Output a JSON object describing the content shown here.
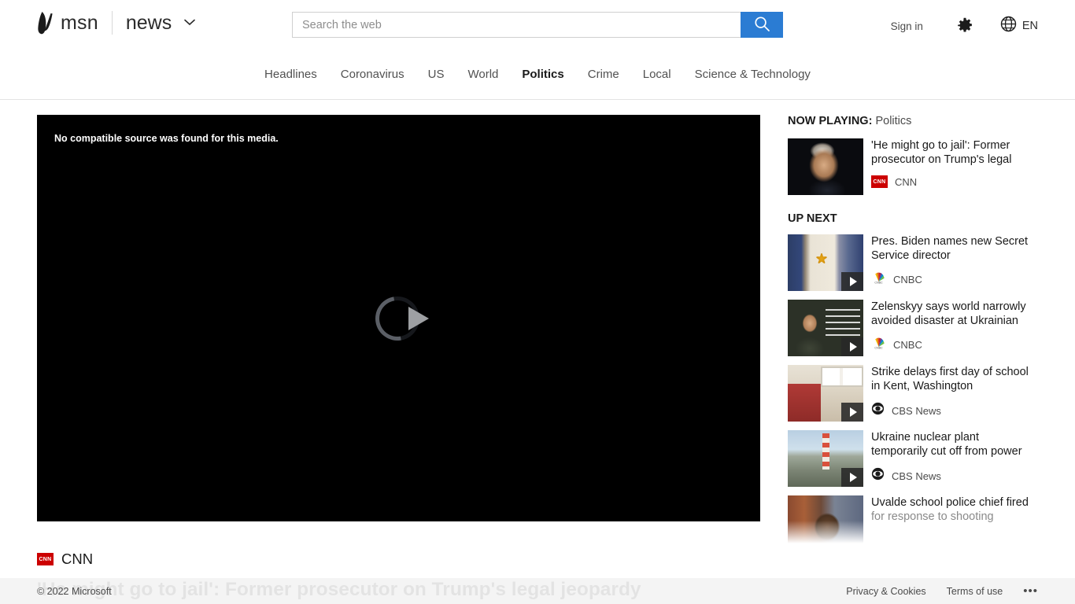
{
  "header": {
    "brand": "msn",
    "brand_logo_icon": "msn-butterfly-logo",
    "vertical": "news",
    "vertical_chevron_icon": "chevron-down-icon",
    "search": {
      "placeholder": "Search the web",
      "value": "",
      "button_icon": "search-icon",
      "button_color": "#2b7cd3"
    },
    "sign_in": "Sign in",
    "settings_icon": "gear-icon",
    "language_icon": "globe-icon",
    "language": "EN"
  },
  "nav": {
    "items": [
      {
        "label": "Headlines",
        "active": false
      },
      {
        "label": "Coronavirus",
        "active": false
      },
      {
        "label": "US",
        "active": false
      },
      {
        "label": "World",
        "active": false
      },
      {
        "label": "Politics",
        "active": true
      },
      {
        "label": "Crime",
        "active": false
      },
      {
        "label": "Local",
        "active": false
      },
      {
        "label": "Science & Technology",
        "active": false
      }
    ]
  },
  "player": {
    "error_message": "No compatible source was found for this media.",
    "spinner_icon": "loading-spinner-icon",
    "play_icon": "play-triangle-icon",
    "source_badge_icon": "cnn-logo-icon",
    "source_badge_text": "CNN",
    "source_badge_color": "#cc0000",
    "source_name": "CNN",
    "article_title": "'He might go to jail': Former prosecutor on Trump's legal jeopardy"
  },
  "sidebar": {
    "now_playing_label": "NOW PLAYING:",
    "now_playing_category": "Politics",
    "up_next_label": "UP NEXT",
    "now_playing_item": {
      "title": "'He might go to jail': Former prosecutor on Trump's legal",
      "source": "CNN",
      "source_icon": "cnn-logo-icon",
      "art": "art-trump",
      "has_play_overlay": false
    },
    "up_next_items": [
      {
        "title": "Pres. Biden names new Secret Service director",
        "source": "CNBC",
        "source_icon": "cnbc-peacock-icon",
        "art": "art-biden",
        "has_play_overlay": true,
        "muted": false
      },
      {
        "title": "Zelenskyy says world narrowly avoided disaster at Ukrainian",
        "source": "CNBC",
        "source_icon": "cnbc-peacock-icon",
        "art": "art-zel",
        "has_play_overlay": true,
        "muted": false
      },
      {
        "title": "Strike delays first day of school in Kent, Washington",
        "source": "CBS News",
        "source_icon": "cbs-eye-icon",
        "art": "art-strike",
        "has_play_overlay": true,
        "muted": false
      },
      {
        "title": "Ukraine nuclear plant temporarily cut off from power",
        "source": "CBS News",
        "source_icon": "cbs-eye-icon",
        "art": "art-nuclear",
        "has_play_overlay": true,
        "muted": false
      },
      {
        "title": "Uvalde school police chief fired",
        "subtitle": "for response to shooting",
        "source": "",
        "source_icon": "",
        "art": "art-uvalde",
        "has_play_overlay": false,
        "muted": true
      }
    ]
  },
  "footer": {
    "copyright": "© 2022 Microsoft",
    "privacy": "Privacy & Cookies",
    "terms": "Terms of use",
    "more_icon": "ellipsis-icon",
    "more": "•••"
  }
}
